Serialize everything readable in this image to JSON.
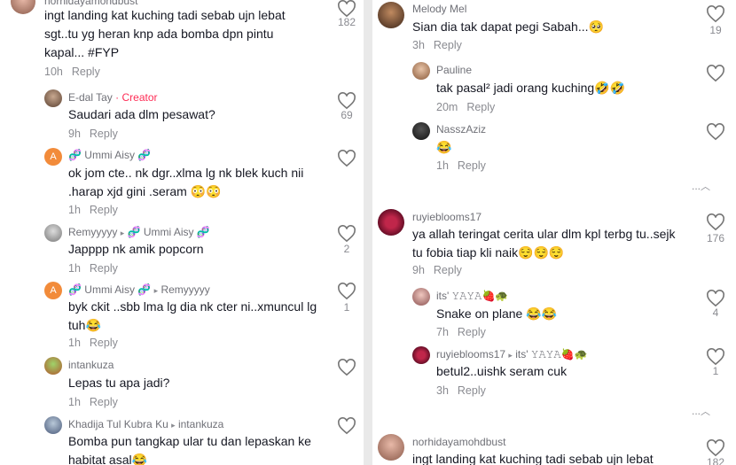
{
  "left": {
    "comments": [
      {
        "name": "norhidayamohdbust",
        "text": "ingt landing kat kuching tadi sebab ujn lebat sgt..tu yg heran knp ada bomba dpn pintu kapal... #FYP",
        "time": "10h",
        "reply": "Reply",
        "likes": "182"
      },
      {
        "name": "E-dal Tay",
        "badge": "· Creator",
        "text": "Saudari ada dlm pesawat?",
        "time": "9h",
        "reply": "Reply",
        "likes": "69"
      },
      {
        "name": "🧬 Ummi Aisy 🧬",
        "text": "ok jom cte.. nk dgr..xlma lg nk blek kuch nii .harap xjd gini .seram 😳😳",
        "time": "1h",
        "reply": "Reply",
        "likes": ""
      },
      {
        "name": "Remyyyyy",
        "arrow": "▸",
        "target": "🧬 Ummi Aisy 🧬",
        "text": "Japppp nk amik popcorn",
        "time": "1h",
        "reply": "Reply",
        "likes": "2"
      },
      {
        "name": "🧬 Ummi Aisy 🧬",
        "arrow": "▸",
        "target": "Remyyyyy",
        "text": "byk ckit ..sbb lma lg dia nk cter ni..xmuncul lg tuh😂",
        "time": "1h",
        "reply": "Reply",
        "likes": "1"
      },
      {
        "name": "intankuza",
        "text": "Lepas tu apa jadi?",
        "time": "1h",
        "reply": "Reply",
        "likes": ""
      },
      {
        "name": "Khadija Tul Kubra Ku",
        "arrow": "▸",
        "target": "intankuza",
        "text": "Bomba pun tangkap ular tu dan lepaskan ke habitat asal😂",
        "time": "",
        "reply": "",
        "likes": ""
      }
    ]
  },
  "right": {
    "comments": [
      {
        "name": "Melody Mel",
        "text": "Sian dia tak dapat pegi Sabah...🥺",
        "time": "3h",
        "reply": "Reply",
        "likes": "19"
      },
      {
        "name": "Pauline",
        "text": "tak pasal² jadi orang kuching🤣🤣",
        "time": "20m",
        "reply": "Reply",
        "likes": ""
      },
      {
        "name": "NasszAziz",
        "text": "😂",
        "time": "1h",
        "reply": "Reply",
        "likes": ""
      },
      {
        "name": "ruyieblooms17",
        "text": "ya allah teringat cerita ular dlm kpl terbg tu..sejk tu fobia tiap kli naik😌😌😌",
        "time": "9h",
        "reply": "Reply",
        "likes": "176"
      },
      {
        "name": "its' 𝚈𝙰𝚈𝙰🍓🐢",
        "text": "Snake on plane 😂😂",
        "time": "7h",
        "reply": "Reply",
        "likes": "4"
      },
      {
        "name": "ruyieblooms17",
        "arrow": "▸",
        "target": "its' 𝚈𝙰𝚈𝙰🍓🐢",
        "text": "betul2..uishk seram cuk",
        "time": "3h",
        "reply": "Reply",
        "likes": "1"
      },
      {
        "name": "norhidayamohdbust",
        "text": "ingt landing kat kuching tadi sebab ujn lebat",
        "time": "",
        "reply": "",
        "likes": "182"
      }
    ],
    "more1": "...",
    "more2": "..."
  },
  "colors": {
    "accent": "#fe2c55",
    "muted": "#8a8b91"
  }
}
